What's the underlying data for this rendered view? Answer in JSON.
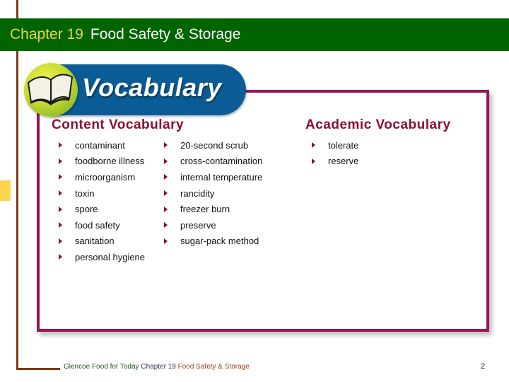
{
  "header": {
    "chapter": "Chapter 19",
    "title": "Food Safety & Storage"
  },
  "banner": {
    "label": "Vocabulary",
    "icon": "open-book-icon"
  },
  "content_vocabulary": {
    "heading": "Content Vocabulary",
    "column1": [
      "contaminant",
      "foodborne illness",
      "microorganism",
      "toxin",
      "spore",
      "food safety",
      "sanitation",
      "personal hygiene"
    ],
    "column2": [
      "20-second scrub",
      "cross-contamination",
      "internal temperature",
      "rancidity",
      "freezer burn",
      "preserve",
      "sugar-pack method"
    ]
  },
  "academic_vocabulary": {
    "heading": "Academic Vocabulary",
    "items": [
      "tolerate",
      "reserve"
    ]
  },
  "footer": {
    "publisher": "Glencoe Food for Today",
    "chapter": "Chapter 19",
    "title": "Food Safety & Storage",
    "page_number": "2"
  },
  "colors": {
    "title_bar": "#006400",
    "chapter_text": "#e5d83a",
    "box_border": "#9c1357",
    "banner": "#0b5c96",
    "heading": "#8c0f2e",
    "side_line": "#7a3b13",
    "tab": "#fbd54e"
  }
}
